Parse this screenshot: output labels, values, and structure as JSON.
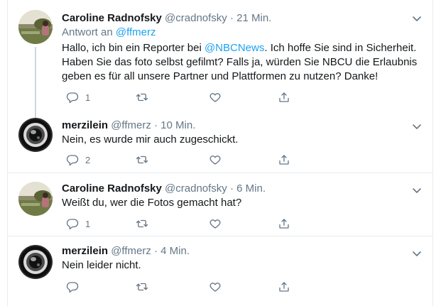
{
  "tweets": [
    {
      "name": "Caroline Radnofsky",
      "handle": "@cradnofsky",
      "dot": "·",
      "time": "21 Min.",
      "reply_prefix": "Antwort an",
      "reply_handle": "@ffmerz",
      "text_before": "Hallo, ich bin ein Reporter bei ",
      "text_link": "@NBCNews",
      "text_after": ". Ich hoffe Sie sind in Sicherheit. Haben Sie das foto selbst gefilmt? Falls ja, würden Sie NBCU die Erlaubnis geben es für all unsere Partner und Plattformen zu nutzen? Danke!",
      "reply_count": "1",
      "avatar": "landscape-photo"
    },
    {
      "name": "merzilein",
      "handle": "@ffmerz",
      "dot": "·",
      "time": "10 Min.",
      "text": "Nein, es wurde mir auch zugeschickt.",
      "reply_count": "2",
      "avatar": "lens-photo"
    },
    {
      "name": "Caroline Radnofsky",
      "handle": "@cradnofsky",
      "dot": "·",
      "time": "6 Min.",
      "text": "Weißt du, wer die Fotos gemacht hat?",
      "reply_count": "1",
      "avatar": "landscape-photo"
    },
    {
      "name": "merzilein",
      "handle": "@ffmerz",
      "dot": "·",
      "time": "4 Min.",
      "text": "Nein leider nicht.",
      "reply_count": "",
      "avatar": "lens-photo"
    }
  ],
  "icons": {
    "reply": "reply-icon",
    "retweet": "retweet-icon",
    "like": "heart-icon",
    "share": "share-icon",
    "more": "chevron-down-icon"
  },
  "colors": {
    "link": "#1da1f2",
    "secondary": "#657786",
    "border": "#e6ecf0",
    "thread": "#ccd6dd"
  }
}
